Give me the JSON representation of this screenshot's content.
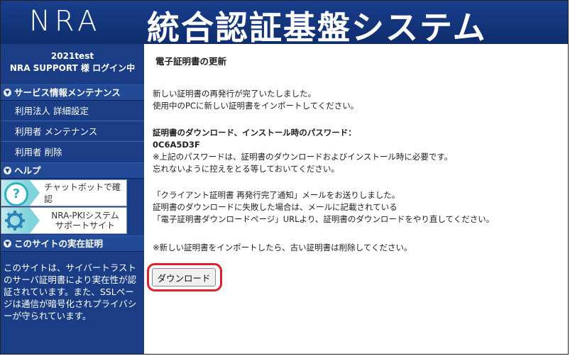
{
  "header": {
    "logo": "NRA",
    "title": "統合認証基盤システム"
  },
  "sidebar": {
    "user_line1": "2021test",
    "user_line2": "NRA SUPPORT 様 ログイン中",
    "sections": [
      {
        "label": "サービス情報メンテナンス"
      },
      {
        "label": "ヘルプ"
      },
      {
        "label": "このサイトの実在証明"
      }
    ],
    "menu": [
      {
        "label": "利用法人 詳細設定"
      },
      {
        "label": "利用者 メンテナンス"
      },
      {
        "label": "利用者 削除"
      }
    ],
    "banners": [
      {
        "text": "チャットボットで確認",
        "icon": "question-icon"
      },
      {
        "line1": "NRA-PKIシステム",
        "line2": "サポートサイト",
        "icon": "gear-icon"
      }
    ],
    "site_info": "このサイトは、サイバートラストのサーバ証明書により実在性が認証されています。また、SSLページは通信が暗号化されプライバシーが守られています。"
  },
  "content": {
    "heading": "電子証明書の更新",
    "p1_line1": "新しい証明書の再発行が完了いたしました。",
    "p1_line2": "使用中のPCに新しい証明書をインポートしてください。",
    "pw_label": "証明書のダウンロード、インストール時のパスワード：",
    "pw_value": "0C6A5D3F",
    "pw_note1": "※上記のパスワードは、証明書のダウンロードおよびインストール時に必要です。",
    "pw_note2": "忘れないように控えをとる等しておいてください。",
    "mail_line1": "「クライアント証明書 再発行完了通知」メールをお送りしました。",
    "mail_line2": "証明書のダウンロードに失敗した場合は、メールに記載されている",
    "mail_line3": "「電子証明書ダウンロードページ」URLより、証明書のダウンロードをやり直してください。",
    "note": "※新しい証明書をインポートしたら、古い証明書は削除してください。",
    "download_button": "ダウンロード"
  },
  "colors": {
    "header_bg": "#123479",
    "sidebar_bg": "#1a3d86",
    "highlight": "#e0202a"
  }
}
